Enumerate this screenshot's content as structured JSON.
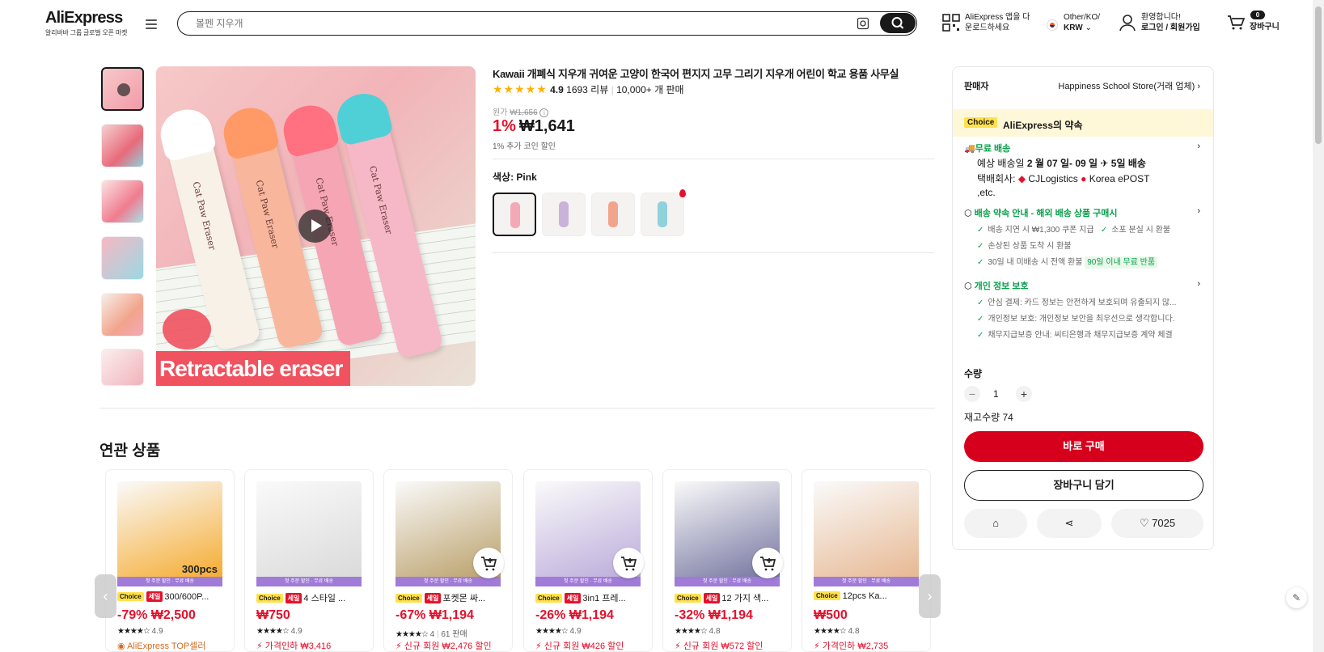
{
  "header": {
    "logo_text": "AliExpress",
    "logo_sub": "알리바바 그룹 글로벌 오픈 마켓",
    "search_placeholder": "볼펜 지우개",
    "app_line1": "AliExpress 앱을 다",
    "app_line2": "운로드하세요",
    "locale_line1": "Other/KO/",
    "locale_line2": "KRW",
    "account_line1": "환영합니다!",
    "account_line2": "로그인 / 회원가입",
    "cart_count": "0",
    "cart_label": "장바구니"
  },
  "product": {
    "title": "Kawaii 개폐식 지우개 귀여운 고양이 한국어 편지지 고무 그리기 지우개 어린이 학교 용품 사무실",
    "rating": "4.9",
    "reviews": "1693 리뷰",
    "sold": "10,000+ 개 판매",
    "orig_label": "원가",
    "orig_price": "₩1,656",
    "discount": "1%",
    "price": "₩1,641",
    "coin_note": "1% 추가 코인 할인",
    "color_label": "색상: Pink",
    "image_banner": "Retractable eraser",
    "pen_label": "Cat Paw Eraser",
    "swatches": [
      {
        "name": "Pink",
        "color": "#f3a9b7"
      },
      {
        "name": "Purple",
        "color": "#c9b3d8"
      },
      {
        "name": "Orange",
        "color": "#f2a48c"
      },
      {
        "name": "Blue",
        "color": "#8fd1dc"
      }
    ]
  },
  "related": {
    "heading": "연관 상품",
    "strip_text": "첫 주문 할인 · 무료 배송",
    "choice_tag": "Choice",
    "sale_tag": "세일",
    "items": [
      {
        "title": "300/600P...",
        "price": "-79% ₩2,500",
        "rating": "4.9",
        "sold": "",
        "extra": "AliExpress TOP셀러",
        "sale": true,
        "img": "#f5a623",
        "overlay": "300pcs"
      },
      {
        "title": "4 스타일 ...",
        "price": "₩750",
        "rating": "4.9",
        "sold": "",
        "extra": "가격인하 ₩3,416",
        "sale": true,
        "img": "#d8d8d8",
        "overlay": ""
      },
      {
        "title": "포켓몬 싸...",
        "price": "-67% ₩1,194",
        "rating": "4",
        "sold": "61 판매",
        "extra": "신규 회원 ₩2,476 할인",
        "sale": true,
        "img": "#b69a60",
        "overlay": ""
      },
      {
        "title": "3in1 프레...",
        "price": "-26% ₩1,194",
        "rating": "4.9",
        "sold": "",
        "extra": "신규 회원 ₩426 할인",
        "sale": true,
        "img": "#b7a6d8",
        "overlay": ""
      },
      {
        "title": "12 가지 색...",
        "price": "-32% ₩1,194",
        "rating": "4.8",
        "sold": "",
        "extra": "신규 회원 ₩572 할인",
        "sale": true,
        "img": "#6b6b9a",
        "overlay": ""
      },
      {
        "title": "12pcs Ka...",
        "price": "₩500",
        "rating": "4.8",
        "sold": "",
        "extra": "가격인하 ₩2,735",
        "sale": false,
        "img": "#e6b48c",
        "overlay": ""
      }
    ]
  },
  "panel": {
    "seller_label": "판매자",
    "seller_name": "Happiness School Store(거래 업체)",
    "choice_tag": "Choice",
    "promise_title": "AliExpress의 약속",
    "free_ship": "무료 배송",
    "delivery_prefix": "예상 배송일",
    "delivery_date": "2 월 07 일- 09 일",
    "delivery_days": "5일 배송",
    "carrier_label": "택배회사:",
    "carrier1": "CJLogistics",
    "carrier2": "Korea ePOST ,etc.",
    "guarantee_title": "배송 약속 안내 - 해외 배송 상품 구매시",
    "g1": "배송 지연 시 ₩1,300 쿠폰 지급",
    "g1b": "소포 분실 시 환불",
    "g2": "손상된 상품 도착 시 환불",
    "g3": "30일 내 미배송 시 전액 환불",
    "g3_badge": "90일 이내 무료 반품",
    "privacy_title": "개인 정보 보호",
    "p1": "안심 결제: 카드 정보는 안전하게 보호되며 유출되지 않...",
    "p2": "개인정보 보호: 개인정보 보안을 최우선으로 생각합니다.",
    "p3": "채무지급보증 안내: 씨티은행과 채무지급보증 계약 체결",
    "qty_label": "수량",
    "qty_value": "1",
    "stock": "재고수량 74",
    "buy_now": "바로 구매",
    "add_cart": "장바구니 담기",
    "wish_count": "7025"
  },
  "colors": {
    "accent": "#e4112b",
    "buy": "#d7001c",
    "green": "#0aa04b"
  }
}
